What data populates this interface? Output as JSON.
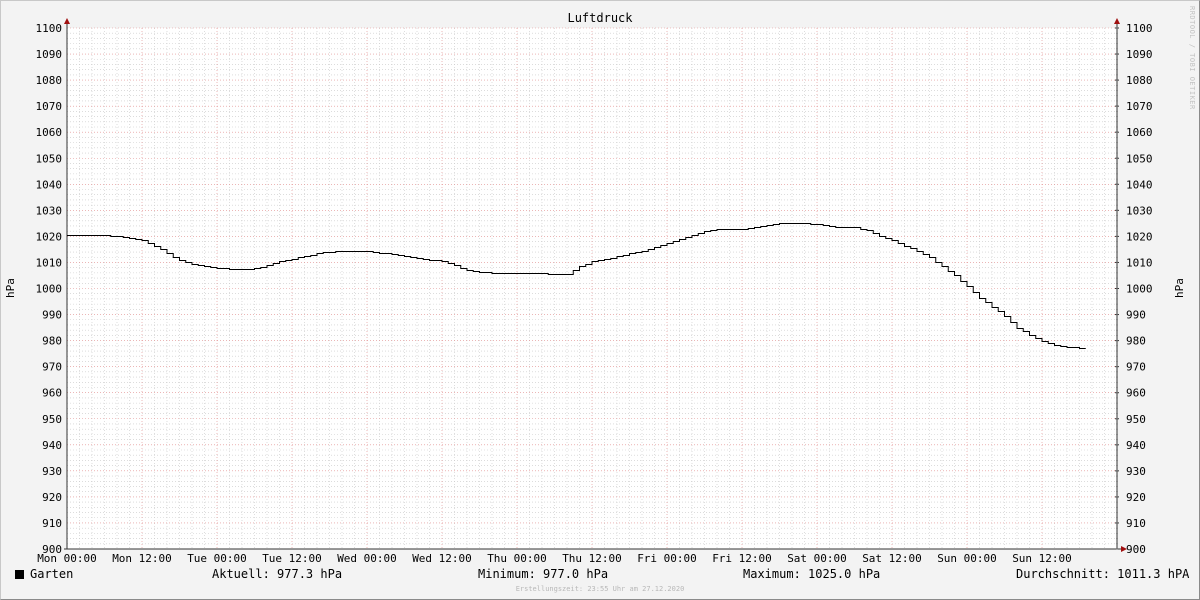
{
  "chart_data": {
    "type": "line",
    "title": "Luftdruck",
    "ylabel": "hPa",
    "ylim": [
      900,
      1100
    ],
    "y_ticks": [
      900,
      910,
      920,
      930,
      940,
      950,
      960,
      970,
      980,
      990,
      1000,
      1010,
      1020,
      1030,
      1040,
      1050,
      1060,
      1070,
      1080,
      1090,
      1100
    ],
    "x_ticks": [
      "Mon 00:00",
      "Mon 12:00",
      "Tue 00:00",
      "Tue 12:00",
      "Wed 00:00",
      "Wed 12:00",
      "Thu 00:00",
      "Thu 12:00",
      "Fri 00:00",
      "Fri 12:00",
      "Sat 00:00",
      "Sat 12:00",
      "Sun 00:00",
      "Sun 12:00"
    ],
    "grid": true,
    "series": [
      {
        "name": "Garten",
        "color": "#000000",
        "points": [
          [
            0,
            1020.5
          ],
          [
            6,
            1020.5
          ],
          [
            8,
            1020
          ],
          [
            10,
            1019.5
          ],
          [
            12,
            1018.5
          ],
          [
            14,
            1016.5
          ],
          [
            16,
            1013.5
          ],
          [
            18,
            1011
          ],
          [
            20,
            1009.5
          ],
          [
            22,
            1008.5
          ],
          [
            24,
            1008
          ],
          [
            26,
            1007.5
          ],
          [
            28,
            1007.3
          ],
          [
            30,
            1007.8
          ],
          [
            32,
            1009
          ],
          [
            34,
            1010.5
          ],
          [
            36,
            1011.5
          ],
          [
            38,
            1012.5
          ],
          [
            40,
            1013.5
          ],
          [
            42,
            1014.2
          ],
          [
            44,
            1014.5
          ],
          [
            46,
            1014.5
          ],
          [
            48,
            1014.3
          ],
          [
            50,
            1013.8
          ],
          [
            52,
            1013.3
          ],
          [
            54,
            1012.5
          ],
          [
            56,
            1011.8
          ],
          [
            58,
            1011
          ],
          [
            60,
            1010.5
          ],
          [
            62,
            1009
          ],
          [
            64,
            1007
          ],
          [
            66,
            1006.3
          ],
          [
            68,
            1006
          ],
          [
            70,
            1005.8
          ],
          [
            72,
            1006
          ],
          [
            74,
            1006
          ],
          [
            76,
            1005.8
          ],
          [
            78,
            1005.5
          ],
          [
            80,
            1005.5
          ],
          [
            82,
            1008.5
          ],
          [
            84,
            1010.5
          ],
          [
            86,
            1011.3
          ],
          [
            88,
            1012.5
          ],
          [
            90,
            1013.5
          ],
          [
            92,
            1014.5
          ],
          [
            94,
            1016
          ],
          [
            96,
            1017.5
          ],
          [
            98,
            1019
          ],
          [
            100,
            1020.5
          ],
          [
            102,
            1022
          ],
          [
            104,
            1023
          ],
          [
            106,
            1023
          ],
          [
            108,
            1023
          ],
          [
            110,
            1023.5
          ],
          [
            112,
            1024.5
          ],
          [
            114,
            1025
          ],
          [
            116,
            1025
          ],
          [
            118,
            1025
          ],
          [
            120,
            1024.8
          ],
          [
            122,
            1024
          ],
          [
            124,
            1023.5
          ],
          [
            126,
            1023.5
          ],
          [
            128,
            1022.5
          ],
          [
            130,
            1020
          ],
          [
            132,
            1018.5
          ],
          [
            134,
            1016.5
          ],
          [
            136,
            1014.5
          ],
          [
            138,
            1012
          ],
          [
            140,
            1008.5
          ],
          [
            142,
            1005
          ],
          [
            144,
            1001
          ],
          [
            146,
            996.5
          ],
          [
            148,
            993
          ],
          [
            150,
            989.5
          ],
          [
            152,
            985
          ],
          [
            154,
            982
          ],
          [
            156,
            980
          ],
          [
            158,
            978.5
          ],
          [
            160,
            977.5
          ],
          [
            162,
            977.3
          ],
          [
            163,
            977.3
          ]
        ]
      }
    ]
  },
  "watermark": "RRDTOOL / TOBI OETIKER",
  "legend": {
    "series_name": "Garten",
    "current": "Aktuell: 977.3 hPa",
    "minimum": "Minimum: 977.0 hPa",
    "maximum": "Maximum: 1025.0 hPa",
    "average": "Durchschnitt: 1011.3 hPA"
  },
  "footer": "Erstellungszeit: 23:55 Uhr am 27.12.2020"
}
